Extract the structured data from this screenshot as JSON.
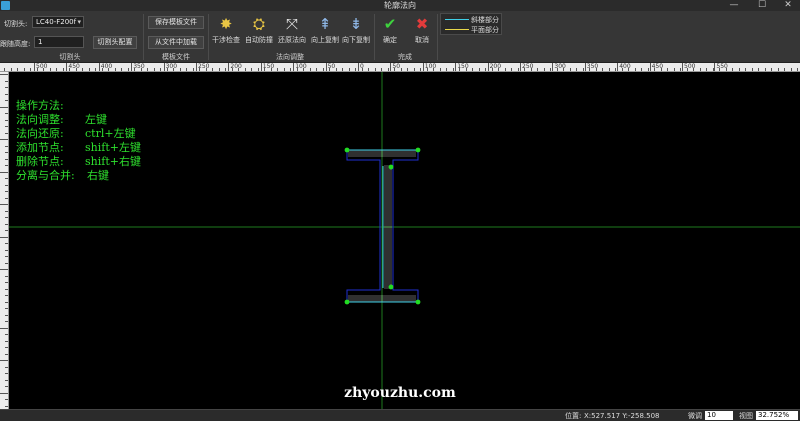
{
  "window": {
    "title": "轮廓法向",
    "min_glyph": "—",
    "max_glyph": "☐",
    "close_glyph": "✕"
  },
  "ribbon": {
    "cutter": {
      "head_label": "切割头:",
      "head_value": "LC40-F200f",
      "height_label": "跟随高度:",
      "height_value": "1",
      "config_button": "切割头配置",
      "group_label": "切割头"
    },
    "template": {
      "save_button": "保存模板文件",
      "load_button": "从文件中加载",
      "group_label": "模板文件"
    },
    "normal": {
      "tools": [
        {
          "label": "干涉检查",
          "icon": "interference-check-icon",
          "glyph": "✸"
        },
        {
          "label": "自动防撞",
          "icon": "auto-anticollision-icon",
          "glyph": "⛭"
        },
        {
          "label": "还原法向",
          "icon": "restore-normal-icon",
          "glyph": "⤧"
        },
        {
          "label": "向上复制",
          "icon": "copy-up-icon",
          "glyph": "⇞"
        },
        {
          "label": "向下复制",
          "icon": "copy-down-icon",
          "glyph": "⇟"
        }
      ],
      "group_label": "法向调整"
    },
    "finish": {
      "confirm_label": "确定",
      "confirm_glyph": "✔",
      "cancel_label": "取消",
      "cancel_glyph": "✖",
      "group_label": "完成"
    },
    "legend": [
      {
        "label": "斜楼部分",
        "color": "#3fd0e8"
      },
      {
        "label": "平面部分",
        "color": "#e8d84a"
      }
    ]
  },
  "rulers": {
    "horizontal_labels": [
      "500",
      "450",
      "400",
      "350",
      "300",
      "250",
      "200",
      "150",
      "100",
      "50",
      "0",
      "50",
      "100",
      "150",
      "200",
      "250",
      "300",
      "350",
      "400",
      "450",
      "500",
      "550"
    ]
  },
  "instructions": {
    "title": "操作方法:",
    "rows": [
      {
        "key": "法向调整:",
        "value": "左键"
      },
      {
        "key": "法向还原:",
        "value": "ctrl+左键"
      },
      {
        "key": "添加节点:",
        "value": "shift+左键"
      },
      {
        "key": "删除节点:",
        "value": "shift+右键"
      },
      {
        "key": "分离与合并:",
        "value": "右键"
      }
    ]
  },
  "watermark": "zhyouzhu.com",
  "status": {
    "position_label": "位置:",
    "position_value": "X:527.517 Y:-258.508",
    "fine_label": "微调",
    "fine_value": "10",
    "view_label": "视图",
    "zoom_value": "32.752%"
  },
  "colors": {
    "profile_outline": "#2030d0",
    "normal_lines": "#a0a0a0",
    "profile_edge": "#3fd0e8",
    "node": "#22dd22",
    "axis": "#1e7a1e"
  }
}
